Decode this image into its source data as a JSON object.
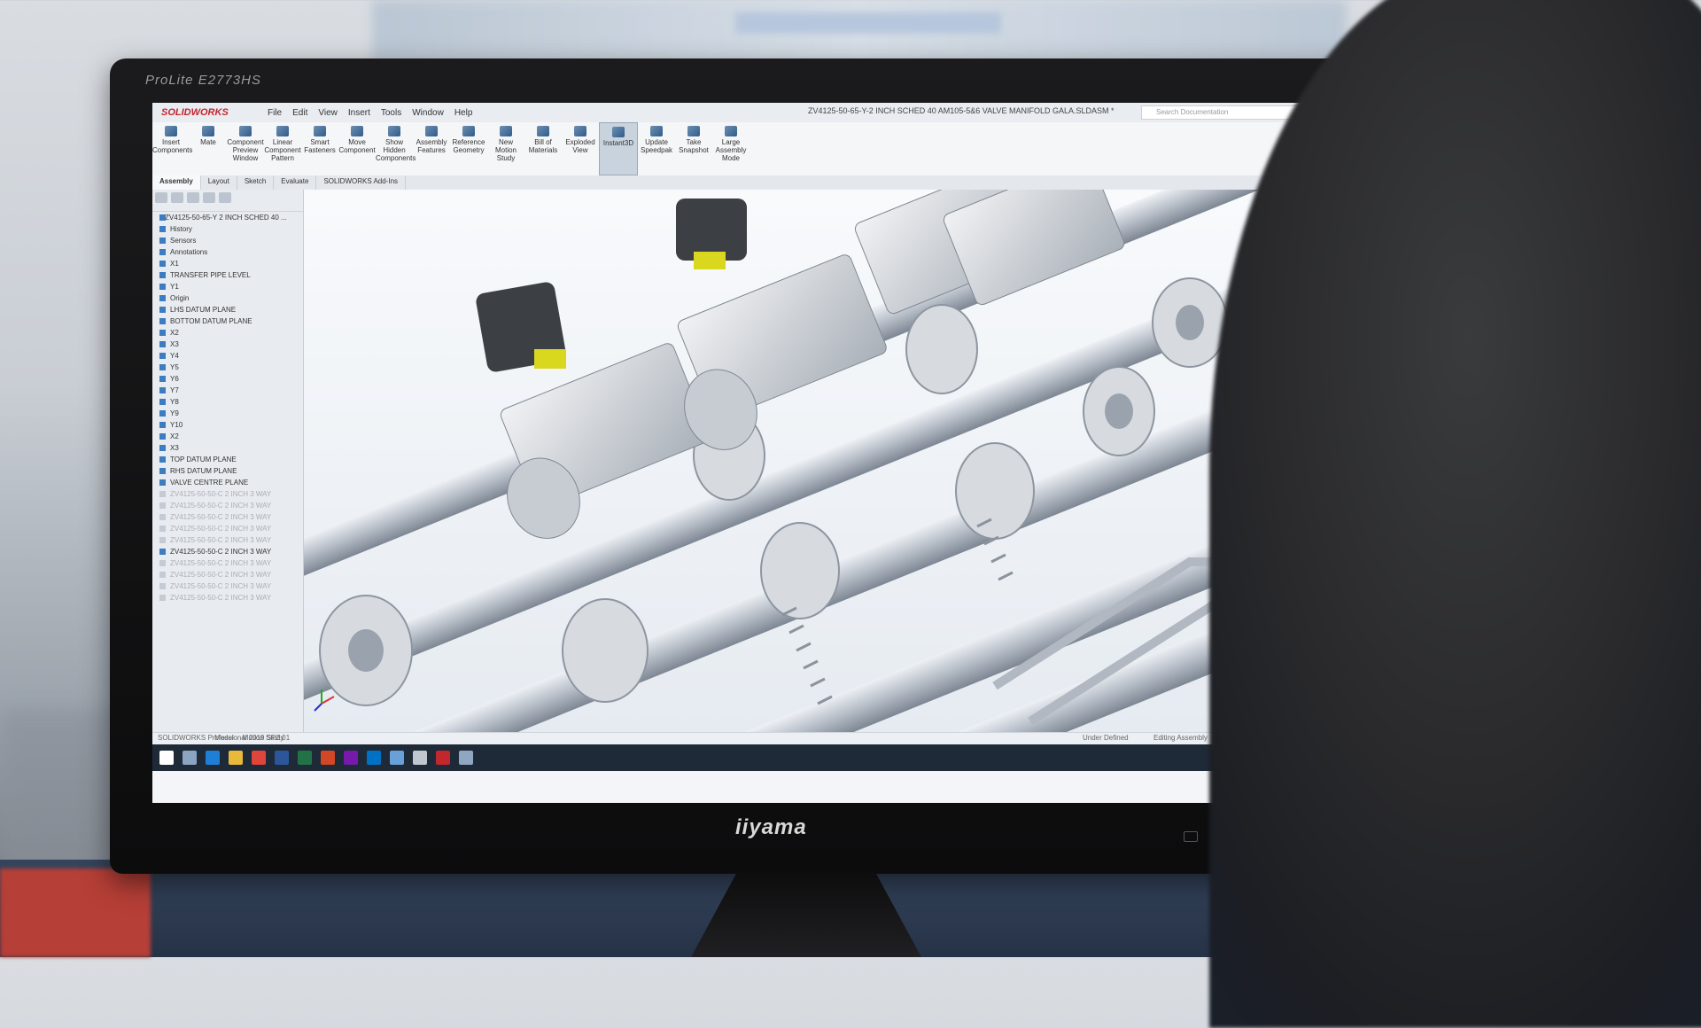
{
  "monitor": {
    "model_label": "ProLite E2773HS",
    "brand_label": "iiyama"
  },
  "app": {
    "logo": "SOLIDWORKS",
    "menu": [
      "File",
      "Edit",
      "View",
      "Insert",
      "Tools",
      "Window",
      "Help"
    ],
    "document_title": "ZV4125-50-65-Y-2 INCH SCHED 40 AM105-5&6 VALVE MANIFOLD GALA.SLDASM *",
    "search_placeholder": "Search Documentation",
    "ribbon_buttons": [
      "Insert Components",
      "Mate",
      "Component Preview Window",
      "Linear Component Pattern",
      "Smart Fasteners",
      "Move Component",
      "Show Hidden Components",
      "Assembly Features",
      "Reference Geometry",
      "New Motion Study",
      "Bill of Materials",
      "Exploded View",
      "Instant3D",
      "Update Speedpak",
      "Take Snapshot",
      "Large Assembly Mode"
    ],
    "active_ribbon_button": "Instant3D",
    "tabs": [
      "Assembly",
      "Layout",
      "Sketch",
      "Evaluate",
      "SOLIDWORKS Add-Ins"
    ],
    "active_tab": "Assembly",
    "tree": {
      "root": "ZV4125-50-65-Y 2 INCH SCHED 40 ...",
      "items": [
        {
          "label": "History",
          "faded": false
        },
        {
          "label": "Sensors",
          "faded": false
        },
        {
          "label": "Annotations",
          "faded": false
        },
        {
          "label": "X1",
          "faded": false
        },
        {
          "label": "TRANSFER PIPE LEVEL",
          "faded": false
        },
        {
          "label": "Y1",
          "faded": false
        },
        {
          "label": "Origin",
          "faded": false
        },
        {
          "label": "LHS DATUM PLANE",
          "faded": false
        },
        {
          "label": "BOTTOM DATUM PLANE",
          "faded": false
        },
        {
          "label": "X2",
          "faded": false
        },
        {
          "label": "X3",
          "faded": false
        },
        {
          "label": "Y4",
          "faded": false
        },
        {
          "label": "Y5",
          "faded": false
        },
        {
          "label": "Y6",
          "faded": false
        },
        {
          "label": "Y7",
          "faded": false
        },
        {
          "label": "Y8",
          "faded": false
        },
        {
          "label": "Y9",
          "faded": false
        },
        {
          "label": "Y10",
          "faded": false
        },
        {
          "label": "X2",
          "faded": false
        },
        {
          "label": "X3",
          "faded": false
        },
        {
          "label": "TOP DATUM PLANE",
          "faded": false
        },
        {
          "label": "RHS DATUM PLANE",
          "faded": false
        },
        {
          "label": "VALVE CENTRE PLANE",
          "faded": false
        },
        {
          "label": "ZV4125-50-50-C 2 INCH 3 WAY",
          "faded": true
        },
        {
          "label": "ZV4125-50-50-C 2 INCH 3 WAY",
          "faded": true
        },
        {
          "label": "ZV4125-50-50-C 2 INCH 3 WAY",
          "faded": true
        },
        {
          "label": "ZV4125-50-50-C 2 INCH 3 WAY",
          "faded": true
        },
        {
          "label": "ZV4125-50-50-C 2 INCH 3 WAY",
          "faded": true
        },
        {
          "label": "ZV4125-50-50-C 2 INCH 3 WAY",
          "faded": false
        },
        {
          "label": "ZV4125-50-50-C 2 INCH 3 WAY",
          "faded": true
        },
        {
          "label": "ZV4125-50-50-C 2 INCH 3 WAY",
          "faded": true
        },
        {
          "label": "ZV4125-50-50-C 2 INCH 3 WAY",
          "faded": true
        },
        {
          "label": "ZV4125-50-50-C 2 INCH 3 WAY",
          "faded": true
        }
      ]
    },
    "bottom_tabs": [
      "Model",
      "Motion Study 1"
    ],
    "status_left": "SOLIDWORKS Professional 2019 SP2.0",
    "status_right": [
      "Under Defined",
      "Editing Assembly"
    ]
  },
  "colors": {
    "brand_red": "#c1272d",
    "tree_icon": "#3d7cc0",
    "valve_yellow": "#d9d81f",
    "taskbar": "#1e2a38"
  }
}
